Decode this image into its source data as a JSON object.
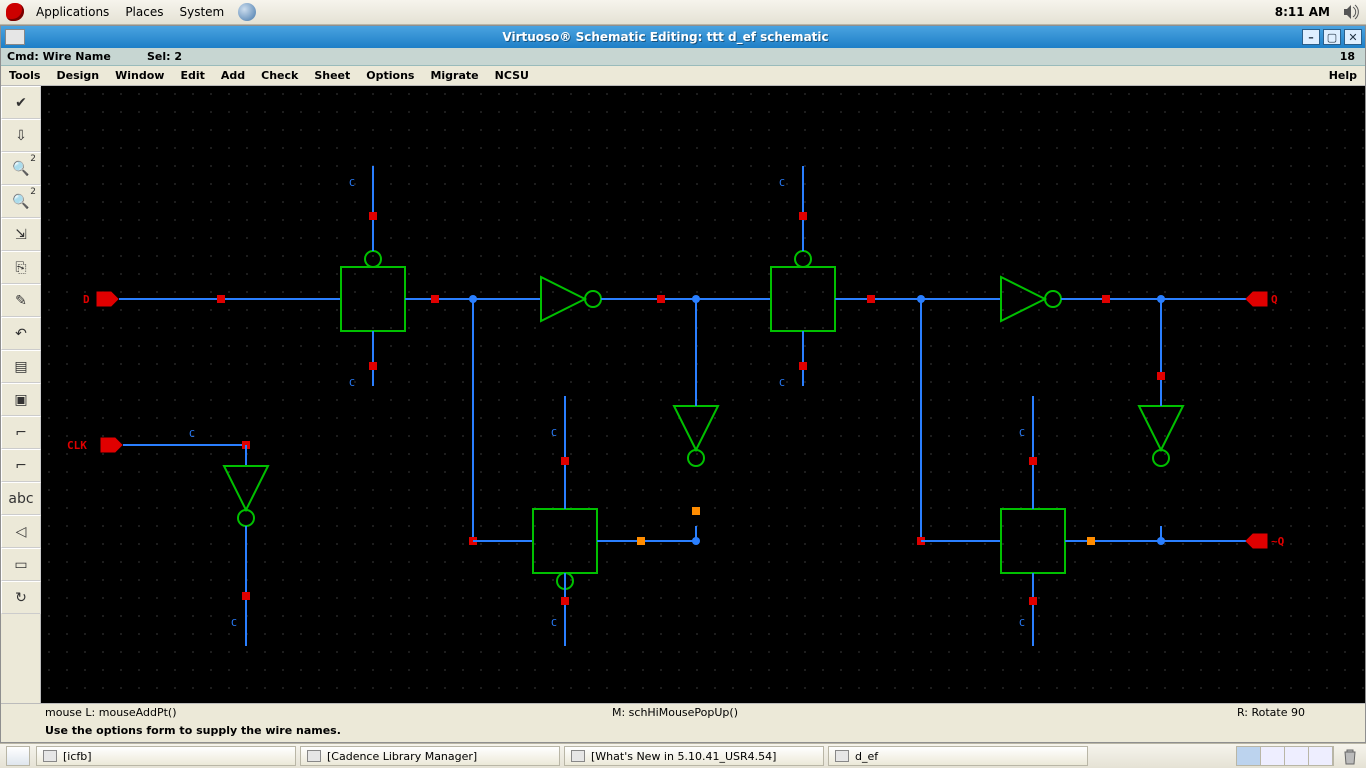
{
  "gnome": {
    "menus": [
      "Applications",
      "Places",
      "System"
    ],
    "clock": "8:11 AM"
  },
  "window": {
    "title": "Virtuoso® Schematic Editing: ttt d_ef schematic",
    "cmd_label": "Cmd:",
    "cmd_value": "Wire Name",
    "sel_label": "Sel:",
    "sel_value": "2",
    "right_num": "18",
    "menus": [
      "Tools",
      "Design",
      "Window",
      "Edit",
      "Add",
      "Check",
      "Sheet",
      "Options",
      "Migrate",
      "NCSU"
    ],
    "help": "Help",
    "mouse_L": "mouse L: mouseAddPt()",
    "mouse_M": "M: schHiMousePopUp()",
    "mouse_R": "R: Rotate 90",
    "hint": "Use the options form to supply the wire names."
  },
  "tools": [
    {
      "name": "check-icon",
      "glyph": "✔"
    },
    {
      "name": "save-icon",
      "glyph": "⇩"
    },
    {
      "name": "zoom-in-icon",
      "glyph": "🔍",
      "sup": "2"
    },
    {
      "name": "zoom-out-icon",
      "glyph": "🔍",
      "sup": "2",
      "sub": "-"
    },
    {
      "name": "stretch-icon",
      "glyph": "⇲"
    },
    {
      "name": "copy-icon",
      "glyph": "⎘"
    },
    {
      "name": "delete-icon",
      "glyph": "✎"
    },
    {
      "name": "undo-icon",
      "glyph": "↶"
    },
    {
      "name": "property-icon",
      "glyph": "▤"
    },
    {
      "name": "instance-icon",
      "glyph": "▣"
    },
    {
      "name": "wire-narrow-icon",
      "glyph": "⌐"
    },
    {
      "name": "wire-wide-icon",
      "glyph": "⌐"
    },
    {
      "name": "wire-name-icon",
      "glyph": "abc"
    },
    {
      "name": "pin-icon",
      "glyph": "◁"
    },
    {
      "name": "sheet-icon",
      "glyph": "▭"
    },
    {
      "name": "repeat-icon",
      "glyph": "↻"
    }
  ],
  "taskbar": {
    "tasks": [
      "[icfb]",
      "[Cadence Library Manager]",
      "[What's New in 5.10.41_USR4.54]",
      "d_ef"
    ]
  },
  "schematic": {
    "pins": {
      "D": "D",
      "CLK": "CLK",
      "Q": "Q",
      "nQ": "~Q"
    },
    "net_label": "C"
  }
}
